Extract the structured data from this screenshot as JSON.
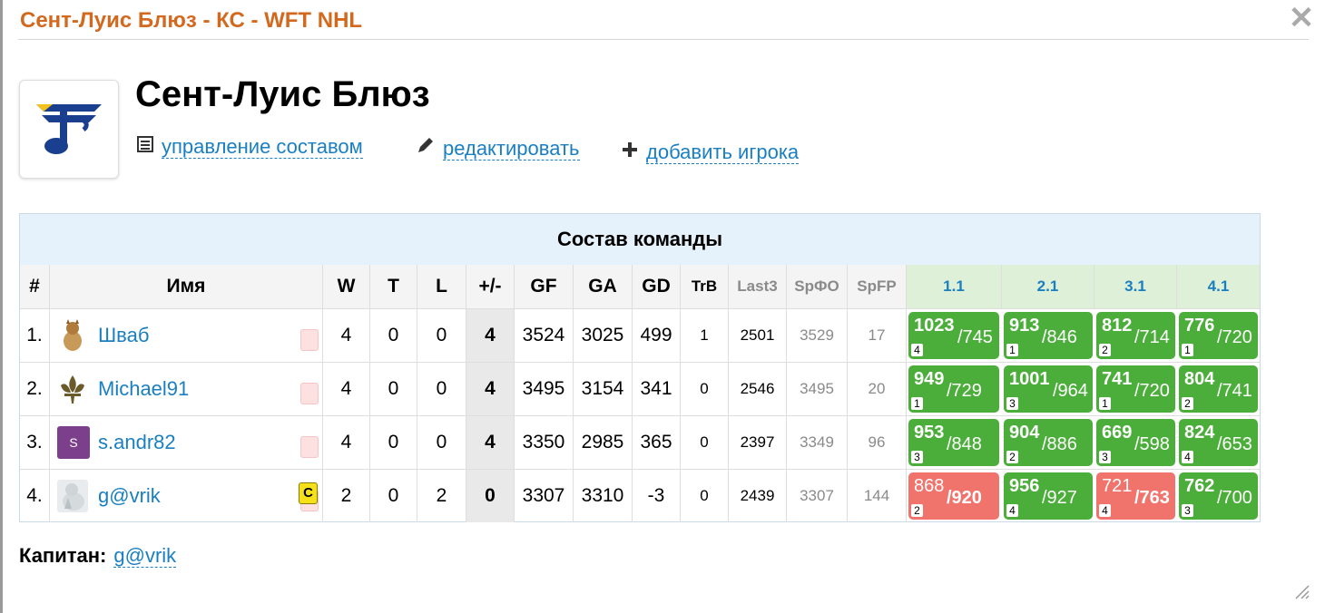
{
  "dialog": {
    "title": "Сент-Луис Блюз - КС - WFT NHL",
    "close_icon": "close-icon"
  },
  "team": {
    "name": "Сент-Луис Блюз",
    "actions": {
      "manage_label": "управление составом",
      "edit_label": "редактировать",
      "add_label": "добавить игрока"
    }
  },
  "roster": {
    "title": "Состав команды",
    "columns": [
      "#",
      "Имя",
      "W",
      "T",
      "L",
      "+/-",
      "GF",
      "GA",
      "GD",
      "TrB",
      "Last3",
      "SpФО",
      "SpFP"
    ],
    "rounds": [
      "1.1",
      "2.1",
      "3.1",
      "4.1"
    ],
    "rows": [
      {
        "num": "1.",
        "name": "Шваб",
        "w": "4",
        "t": "0",
        "l": "0",
        "pm": "4",
        "gf": "3524",
        "ga": "3025",
        "gd": "499",
        "trb": "1",
        "last3": "2501",
        "spfo": "3529",
        "spfp": "17",
        "captain": false,
        "games": [
          {
            "score": "1023",
            "opp": "/745",
            "pos": "4",
            "result": "win"
          },
          {
            "score": "913",
            "opp": "/846",
            "pos": "1",
            "result": "win"
          },
          {
            "score": "812",
            "opp": "/714",
            "pos": "2",
            "result": "win"
          },
          {
            "score": "776",
            "opp": "/720",
            "pos": "1",
            "result": "win"
          }
        ]
      },
      {
        "num": "2.",
        "name": "Michael91",
        "w": "4",
        "t": "0",
        "l": "0",
        "pm": "4",
        "gf": "3495",
        "ga": "3154",
        "gd": "341",
        "trb": "0",
        "last3": "2546",
        "spfo": "3495",
        "spfp": "20",
        "captain": false,
        "games": [
          {
            "score": "949",
            "opp": "/729",
            "pos": "1",
            "result": "win"
          },
          {
            "score": "1001",
            "opp": "/964",
            "pos": "3",
            "result": "win"
          },
          {
            "score": "741",
            "opp": "/720",
            "pos": "1",
            "result": "win"
          },
          {
            "score": "804",
            "opp": "/741",
            "pos": "2",
            "result": "win"
          }
        ]
      },
      {
        "num": "3.",
        "name": "s.andr82",
        "w": "4",
        "t": "0",
        "l": "0",
        "pm": "4",
        "gf": "3350",
        "ga": "2985",
        "gd": "365",
        "trb": "0",
        "last3": "2397",
        "spfo": "3349",
        "spfp": "96",
        "captain": false,
        "avatar_letter": "S",
        "games": [
          {
            "score": "953",
            "opp": "/848",
            "pos": "3",
            "result": "win"
          },
          {
            "score": "904",
            "opp": "/886",
            "pos": "2",
            "result": "win"
          },
          {
            "score": "669",
            "opp": "/598",
            "pos": "3",
            "result": "win"
          },
          {
            "score": "824",
            "opp": "/653",
            "pos": "4",
            "result": "win"
          }
        ]
      },
      {
        "num": "4.",
        "name": "g@vrik",
        "w": "2",
        "t": "0",
        "l": "2",
        "pm": "0",
        "gf": "3307",
        "ga": "3310",
        "gd": "-3",
        "trb": "0",
        "last3": "2439",
        "spfo": "3307",
        "spfp": "144",
        "captain": true,
        "captain_badge": "C",
        "games": [
          {
            "score": "868",
            "opp": "/920",
            "pos": "2",
            "result": "lose"
          },
          {
            "score": "956",
            "opp": "/927",
            "pos": "4",
            "result": "win"
          },
          {
            "score": "721",
            "opp": "/763",
            "pos": "4",
            "result": "lose"
          },
          {
            "score": "762",
            "opp": "/700",
            "pos": "3",
            "result": "win"
          }
        ]
      }
    ]
  },
  "captain": {
    "label": "Капитан:",
    "name": "g@vrik"
  },
  "colors": {
    "accent": "#d2691e",
    "link": "#1a7fc1",
    "win": "#4cae3a",
    "lose": "#f0736c"
  }
}
